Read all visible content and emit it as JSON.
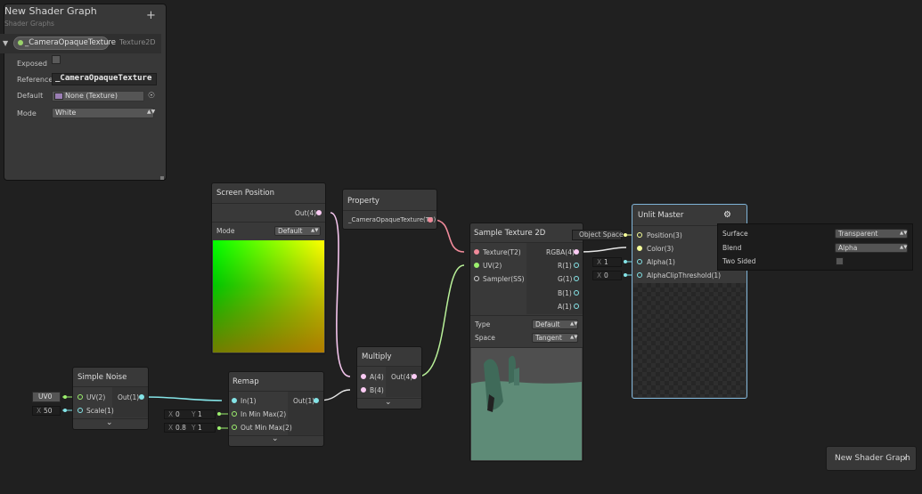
{
  "blackboard": {
    "title": "New Shader Graph",
    "subtitle": "Shader Graphs",
    "add_icon": "+",
    "property": {
      "name": "_CameraOpaqueTexture",
      "type": "Texture2D",
      "exposed_label": "Exposed",
      "exposed": false,
      "reference_label": "Reference",
      "reference_value": "_CameraOpaqueTexture",
      "default_label": "Default",
      "default_value": "None (Texture)",
      "mode_label": "Mode",
      "mode_value": "White"
    }
  },
  "nodes": {
    "screen_position": {
      "title": "Screen Position",
      "out": "Out(4)",
      "mode_label": "Mode",
      "mode_value": "Default"
    },
    "property": {
      "title": "Property",
      "out": "_CameraOpaqueTexture(T2)"
    },
    "sample_texture": {
      "title": "Sample Texture 2D",
      "inputs": [
        "Texture(T2)",
        "UV(2)",
        "Sampler(SS)"
      ],
      "outputs": [
        "RGBA(4)",
        "R(1)",
        "G(1)",
        "B(1)",
        "A(1)"
      ],
      "type_label": "Type",
      "type_value": "Default",
      "space_label": "Space",
      "space_value": "Tangent"
    },
    "multiply": {
      "title": "Multiply",
      "inputs": [
        "A(4)",
        "B(4)"
      ],
      "out": "Out(4)"
    },
    "simple_noise": {
      "title": "Simple Noise",
      "inputs": [
        "UV(2)",
        "Scale(1)"
      ],
      "out": "Out(1)",
      "uv_field": "UV0",
      "scale_axis": "X",
      "scale_value": "50"
    },
    "remap": {
      "title": "Remap",
      "inputs": [
        "In(1)",
        "In Min Max(2)",
        "Out Min Max(2)"
      ],
      "out": "Out(1)",
      "in_min_max": {
        "x_label": "X",
        "x": "0",
        "y_label": "Y",
        "y": "1"
      },
      "out_min_max": {
        "x_label": "X",
        "x": "0.8",
        "y_label": "Y",
        "y": "1"
      }
    },
    "unlit_master": {
      "title": "Unlit Master",
      "inputs": [
        "Position(3)",
        "Color(3)",
        "Alpha(1)",
        "AlphaClipThreshold(1)"
      ],
      "position_field": "Object Space",
      "alpha_axis": "X",
      "alpha_value": "1",
      "clip_axis": "X",
      "clip_value": "0",
      "settings": {
        "surface_label": "Surface",
        "surface_value": "Transparent",
        "blend_label": "Blend",
        "blend_value": "Alpha",
        "two_sided_label": "Two Sided",
        "two_sided": false
      }
    }
  },
  "corner_button": {
    "label": "New Shader Graph",
    "icon": "chevron-left-icon",
    "glyph": "‹"
  },
  "colors": {
    "background": "#202020",
    "node": "#393939",
    "texture_port": "#f08a9a",
    "vector2_port": "#9cf06e",
    "vector4_port": "#fbcbf4",
    "float_port": "#84e4e7",
    "vector3_port": "#f6ff9a",
    "master_highlight": "#7fb4d8"
  }
}
